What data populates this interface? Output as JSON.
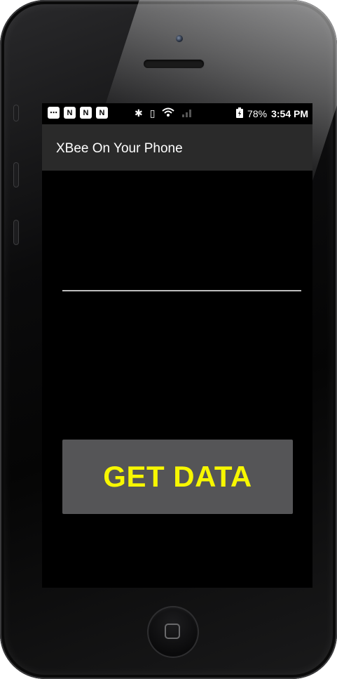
{
  "status_bar": {
    "battery_percent": "78%",
    "time": "3:54 PM",
    "icons": [
      "chat-icon",
      "notification-n-icon",
      "notification-n-icon",
      "notification-n-icon",
      "bluetooth-icon",
      "vibrate-icon",
      "wifi-icon",
      "signal-icon",
      "battery-charging-icon"
    ]
  },
  "app_bar": {
    "title": "XBee On Your Phone"
  },
  "main": {
    "get_data_label": "GET DATA"
  },
  "colors": {
    "button_bg": "#555557",
    "button_text": "#f7f700",
    "app_bar_bg": "#2a2a2a",
    "screen_bg": "#000000"
  }
}
